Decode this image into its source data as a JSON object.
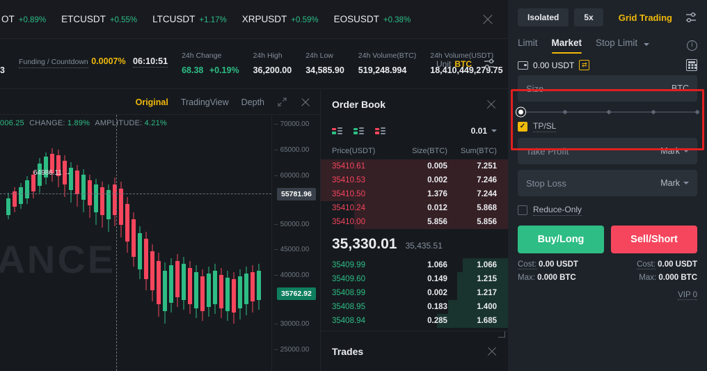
{
  "tickers": [
    {
      "symbol": "OT",
      "change": "+0.89%"
    },
    {
      "symbol": "ETCUSDT",
      "change": "+0.55%"
    },
    {
      "symbol": "LTCUSDT",
      "change": "+1.17%"
    },
    {
      "symbol": "XRPUSDT",
      "change": "+0.59%"
    },
    {
      "symbol": "EOSUSDT",
      "change": "+0.38%"
    }
  ],
  "stats": {
    "mark_price_partial": "3",
    "funding_label": "Funding / Countdown",
    "funding_rate": "0.0007%",
    "countdown": "06:10:51",
    "change_label": "24h Change",
    "change_value": "68.38",
    "change_pct": "+0.19%",
    "high_label": "24h High",
    "high_value": "36,200.00",
    "low_label": "24h Low",
    "low_value": "34,585.90",
    "vol_btc_label": "24h Volume(BTC)",
    "vol_btc_value": "519,248.994",
    "vol_usdt_label": "24h Volume(USDT)",
    "vol_usdt_value": "18,410,449,279.75",
    "unit_label": "Unit",
    "unit_value": "BTC"
  },
  "chart": {
    "tabs": [
      {
        "label": "Original",
        "active": true
      },
      {
        "label": "TradingView",
        "active": false
      },
      {
        "label": "Depth",
        "active": false
      }
    ],
    "info_price": "006.25",
    "info_change_label": "CHANGE:",
    "info_change_value": "1.89%",
    "info_amplitude_label": "AMPLITUDE:",
    "info_amplitude_value": "4.21%",
    "peak_label": "64986.11",
    "watermark": "NANCE",
    "axis_ticks": [
      "70000.00",
      "65000.00",
      "60000.00",
      "50000.00",
      "45000.00",
      "40000.00",
      "30000.00",
      "25000.00"
    ],
    "tag_grey": "55781.96",
    "tag_green": "35762.92"
  },
  "orderbook": {
    "title": "Order Book",
    "precision": "0.01",
    "columns": [
      "Price(USDT)",
      "Size(BTC)",
      "Sum(BTC)"
    ],
    "asks": [
      {
        "price": "35410.61",
        "size": "0.005",
        "sum": "7.251",
        "depth": 100
      },
      {
        "price": "35410.53",
        "size": "0.002",
        "sum": "7.246",
        "depth": 100
      },
      {
        "price": "35410.50",
        "size": "1.376",
        "sum": "7.244",
        "depth": 100
      },
      {
        "price": "35410.24",
        "size": "0.012",
        "sum": "5.868",
        "depth": 82
      },
      {
        "price": "35410.00",
        "size": "5.856",
        "sum": "5.856",
        "depth": 82
      }
    ],
    "mid_price": "35,330.01",
    "mid_secondary": "35,435.51",
    "bids": [
      {
        "price": "35409.99",
        "size": "1.066",
        "sum": "1.066",
        "depth": 24
      },
      {
        "price": "35409.60",
        "size": "0.149",
        "sum": "1.215",
        "depth": 27
      },
      {
        "price": "35408.99",
        "size": "0.002",
        "sum": "1.217",
        "depth": 27
      },
      {
        "price": "35408.95",
        "size": "0.183",
        "sum": "1.400",
        "depth": 32
      },
      {
        "price": "35408.94",
        "size": "0.285",
        "sum": "1.685",
        "depth": 38
      }
    ]
  },
  "trades": {
    "title": "Trades"
  },
  "panel": {
    "margin_mode": "Isolated",
    "leverage": "5x",
    "grid_trading": "Grid Trading",
    "order_tabs": [
      {
        "label": "Limit",
        "active": false
      },
      {
        "label": "Market",
        "active": true
      },
      {
        "label": "Stop Limit",
        "active": false
      }
    ],
    "balance": "0.00 USDT",
    "size_placeholder": "Size",
    "size_unit": "BTC",
    "slider_value": 0,
    "tpsl_label": "TP/SL",
    "tpsl_checked": true,
    "take_profit_placeholder": "Take Profit",
    "take_profit_ref": "Mark",
    "stop_loss_placeholder": "Stop Loss",
    "stop_loss_ref": "Mark",
    "reduce_only_label": "Reduce-Only",
    "reduce_only_checked": false,
    "buy_label": "Buy/Long",
    "sell_label": "Sell/Short",
    "buy_cost_label": "Cost:",
    "buy_cost_value": "0.00 USDT",
    "buy_max_label": "Max:",
    "buy_max_value": "0.000 BTC",
    "sell_cost_label": "Cost:",
    "sell_cost_value": "0.00 USDT",
    "sell_max_label": "Max:",
    "sell_max_value": "0.000 BTC",
    "vip_label": "VIP 0"
  },
  "colors": {
    "accent": "#f0b90b",
    "buy_green": "#2ebd85",
    "sell_red": "#f6465d",
    "highlight": "#e02020"
  }
}
